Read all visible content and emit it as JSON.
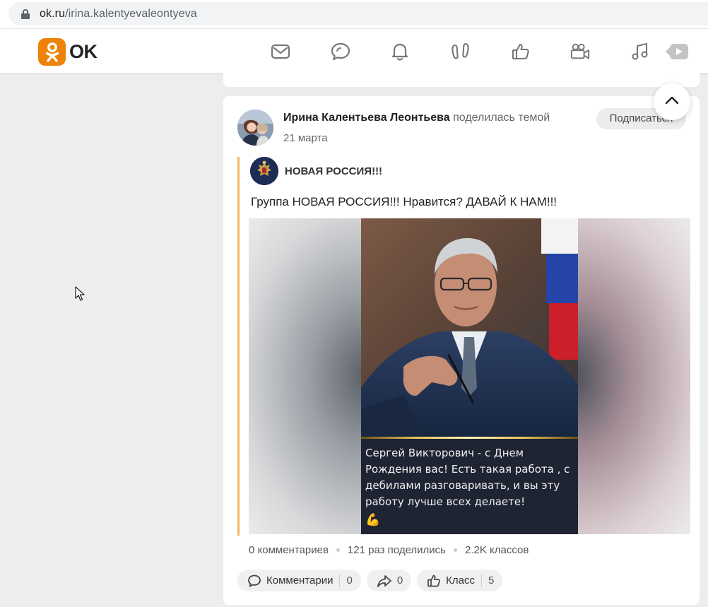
{
  "browser": {
    "url_host": "ok.ru",
    "url_path": "/irina.kalentyevaleontyeva"
  },
  "header": {
    "logo_text": "OK",
    "nav_icons": [
      "mail-icon",
      "discussions-icon",
      "notifications-icon",
      "guests-icon",
      "likes-icon",
      "video-icon",
      "music-icon",
      "video-play-icon"
    ]
  },
  "post": {
    "author_name": "Ирина Калентьева Леонтьева",
    "author_action": " поделилась темой",
    "date": "21 марта",
    "subscribe_label": "Подписаться",
    "group_name": "НОВАЯ РОССИЯ!!!",
    "share_text": "Группа НОВАЯ РОССИЯ!!! Нравится? ДАВАЙ К НАМ!!!",
    "media": {
      "caption": "Сергей Викторович -  с Днем Рождения вас!  Есть такая работа , с дебилами разговаривать, и вы эту работу лучше всех делаете!",
      "caption_emoji": "💪"
    },
    "stats": {
      "comments": "0 комментариев",
      "shares": "121 раз поделились",
      "classes": "2.2K классов"
    },
    "actions": {
      "comment_label": "Комментарии",
      "comment_count": "0",
      "share_count": "0",
      "like_label": "Класс",
      "like_count": "5"
    }
  },
  "colors": {
    "ok_orange": "#ee8208",
    "quote_bar": "#f5b75f",
    "pill_bg": "#f0f0f0",
    "page_bg": "#ededed"
  }
}
